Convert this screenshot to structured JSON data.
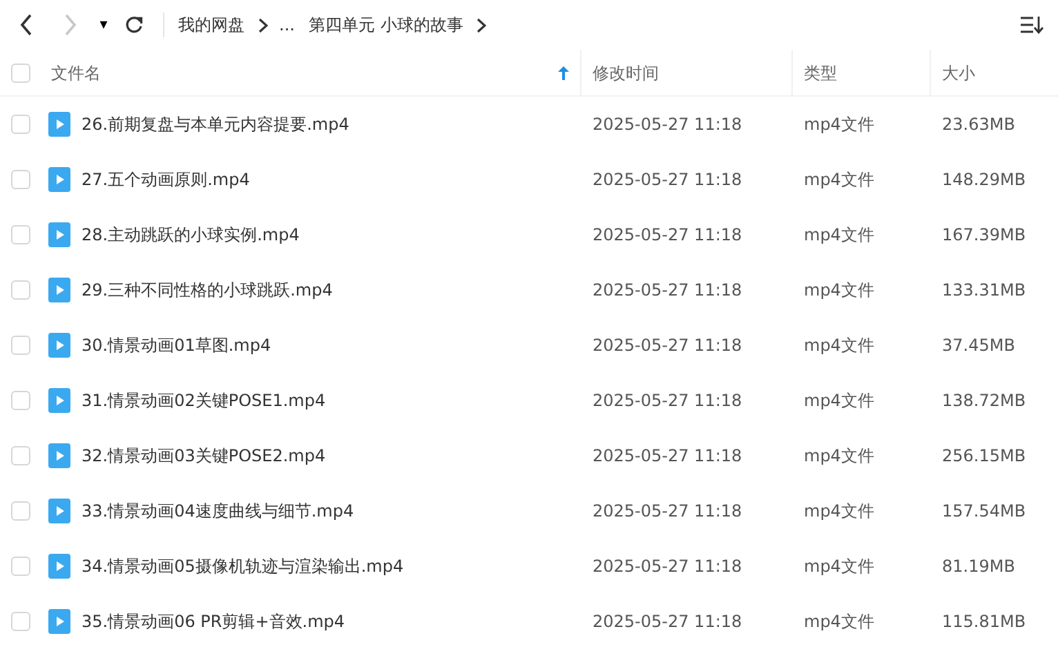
{
  "toolbar": {
    "back": {
      "disabled": false
    },
    "forward": {
      "disabled": true
    },
    "dropdown": "▾",
    "breadcrumb": [
      {
        "text": "我的网盘"
      },
      {
        "text": "...",
        "kind": "ellipsis"
      },
      {
        "text": "第四单元 小球的故事"
      }
    ]
  },
  "table": {
    "select_all": {
      "checked": false
    },
    "columns": [
      {
        "label": "文件名",
        "sorted": true
      },
      {
        "label": "修改时间",
        "sorted": false
      },
      {
        "label": "类型",
        "sorted": false
      },
      {
        "label": "大小",
        "sorted": false
      }
    ],
    "rows": [
      {
        "name": "26.前期复盘与本单元内容提要.mp4",
        "time": "2025-05-27 11:18",
        "type": "mp4文件",
        "size": "23.63MB",
        "checked": false
      },
      {
        "name": "27.五个动画原则.mp4",
        "time": "2025-05-27 11:18",
        "type": "mp4文件",
        "size": "148.29MB",
        "checked": false
      },
      {
        "name": "28.主动跳跃的小球实例.mp4",
        "time": "2025-05-27 11:18",
        "type": "mp4文件",
        "size": "167.39MB",
        "checked": false
      },
      {
        "name": "29.三种不同性格的小球跳跃.mp4",
        "time": "2025-05-27 11:18",
        "type": "mp4文件",
        "size": "133.31MB",
        "checked": false
      },
      {
        "name": "30.情景动画01草图.mp4",
        "time": "2025-05-27 11:18",
        "type": "mp4文件",
        "size": "37.45MB",
        "checked": false
      },
      {
        "name": "31.情景动画02关键POSE1.mp4",
        "time": "2025-05-27 11:18",
        "type": "mp4文件",
        "size": "138.72MB",
        "checked": false
      },
      {
        "name": "32.情景动画03关键POSE2.mp4",
        "time": "2025-05-27 11:18",
        "type": "mp4文件",
        "size": "256.15MB",
        "checked": false
      },
      {
        "name": "33.情景动画04速度曲线与细节.mp4",
        "time": "2025-05-27 11:18",
        "type": "mp4文件",
        "size": "157.54MB",
        "checked": false
      },
      {
        "name": "34.情景动画05摄像机轨迹与渲染输出.mp4",
        "time": "2025-05-27 11:18",
        "type": "mp4文件",
        "size": "81.19MB",
        "checked": false
      },
      {
        "name": "35.情景动画06 PR剪辑+音效.mp4",
        "time": "2025-05-27 11:18",
        "type": "mp4文件",
        "size": "115.81MB",
        "checked": false
      }
    ]
  }
}
